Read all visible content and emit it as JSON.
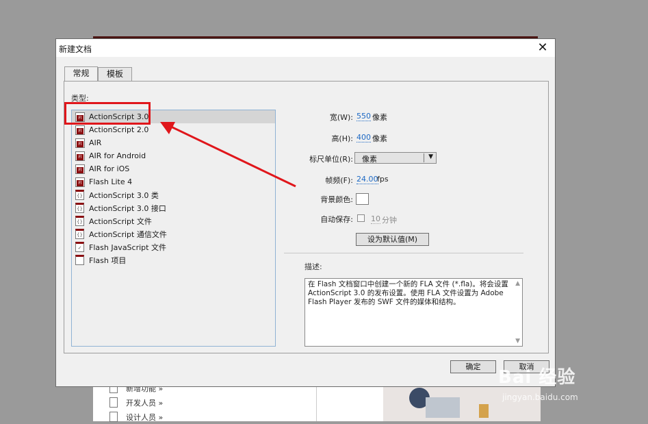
{
  "dialog": {
    "title": "新建文档",
    "close_icon": "close-icon",
    "tabs": [
      {
        "label": "常规",
        "active": true
      },
      {
        "label": "模板",
        "active": false
      }
    ],
    "type_label": "类型:",
    "types": [
      {
        "label": "ActionScript 3.0",
        "icon": "fla-icon",
        "selected": true
      },
      {
        "label": "ActionScript 2.0",
        "icon": "fla-icon"
      },
      {
        "label": "AIR",
        "icon": "fla-icon"
      },
      {
        "label": "AIR for Android",
        "icon": "fla-icon"
      },
      {
        "label": "AIR for iOS",
        "icon": "fla-icon"
      },
      {
        "label": "Flash Lite 4",
        "icon": "fla-icon"
      },
      {
        "label": "ActionScript 3.0 类",
        "icon": "as-class-icon"
      },
      {
        "label": "ActionScript 3.0 接口",
        "icon": "as-interface-icon"
      },
      {
        "label": "ActionScript 文件",
        "icon": "as-file-icon"
      },
      {
        "label": "ActionScript 通信文件",
        "icon": "asc-file-icon"
      },
      {
        "label": "Flash JavaScript 文件",
        "icon": "jsfl-file-icon"
      },
      {
        "label": "Flash 项目",
        "icon": "flash-project-icon"
      }
    ],
    "width": {
      "label": "宽(W):",
      "value": "550",
      "unit": "像素"
    },
    "height": {
      "label": "高(H):",
      "value": "400",
      "unit": "像素"
    },
    "ruler_units": {
      "label": "标尺单位(R):",
      "value": "像素"
    },
    "frame_rate": {
      "label": "帧频(F):",
      "value": "24.00",
      "unit": "fps"
    },
    "bg_color": {
      "label": "背景颜色:",
      "color": "#ffffff"
    },
    "autosave": {
      "label": "自动保存:",
      "value": "10",
      "unit": "分钟"
    },
    "set_default_label": "设为默认值(M)",
    "description_label": "描述:",
    "description": "在 Flash 文档窗口中创建一个新的 FLA 文件 (*.fla)。将会设置 ActionScript 3.0 的发布设置。使用 FLA 文件设置为 Adobe Flash Player 发布的 SWF 文件的媒体和结构。",
    "ok_label": "确定",
    "cancel_label": "取消"
  },
  "background": {
    "items": [
      "新增功能 »",
      "开发人员 »",
      "设计人员 »"
    ]
  },
  "watermark": {
    "main": "Bai 经验",
    "sub": "jingyan.baidu.com"
  },
  "colors": {
    "accent": "#e0161b",
    "link": "#1d69c4",
    "flash_red": "#8b0d10"
  }
}
